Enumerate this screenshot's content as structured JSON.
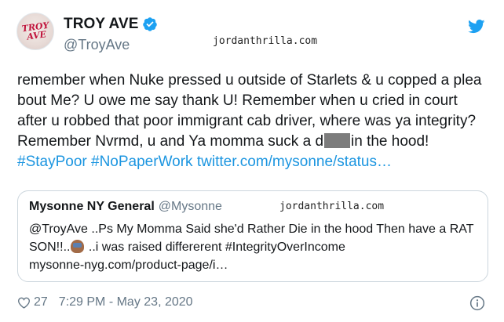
{
  "author": {
    "display_name": "TROY AVE",
    "handle": "@TroyAve",
    "avatar_text": "TROY AVE"
  },
  "watermark": "jordanthrilla.com",
  "tweet": {
    "text_a": "remember when Nuke pressed u outside of Starlets & u copped a plea bout Me? U owe me say thank U! Remember when u cried in court after u robbed that poor immigrant cab driver, where was ya integrity? Remember Nvrmd, u and Ya momma suck a ",
    "text_b_censored_prefix": "d",
    "text_c": "in the hood! ",
    "hashtag_1": "#StayPoor",
    "hashtag_2": "#NoPaperWork",
    "link": "twitter.com/mysonne/status…"
  },
  "quoted_tweet": {
    "display_name": "Mysonne NY General",
    "handle": "@Mysonne",
    "text_a": "@TroyAve ..Ps My Momma Said she'd Rather Die in the hood Then have a RAT SON!!..",
    "text_b": " ..i was raised differerent #IntegrityOverIncome",
    "link": "mysonne-nyg.com/product-page/i…"
  },
  "footer": {
    "like_count": "27",
    "timestamp": "7:29 PM - May 23, 2020"
  },
  "colors": {
    "link": "#1b95e0",
    "verified": "#1da1f2",
    "twitter_bird": "#1da1f2",
    "muted": "#657786"
  },
  "icons": [
    "verified-badge-icon",
    "twitter-bird-icon",
    "heart-icon",
    "info-icon",
    "shrug-emoji"
  ]
}
